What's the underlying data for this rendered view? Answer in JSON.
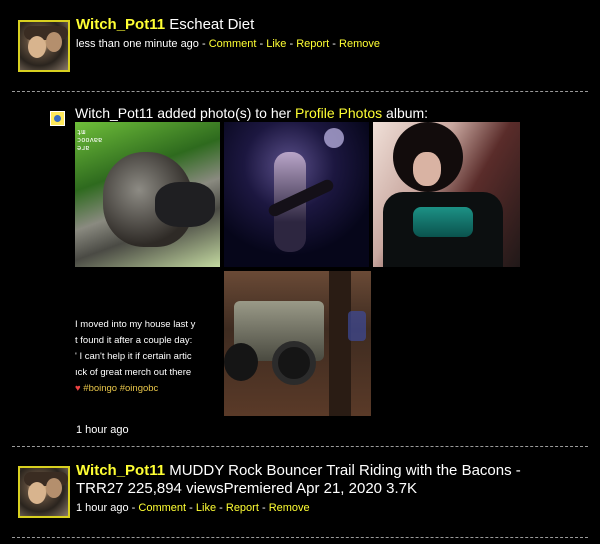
{
  "posts": [
    {
      "user": "Witch_Pot11",
      "text": "Escheat Diet",
      "time": "less than one minute ago",
      "actions": [
        "Comment",
        "Like",
        "Report",
        "Remove"
      ]
    },
    {
      "user": "Witch_Pot11",
      "text": "MUDDY Rock Bouncer Trail Riding with the Bacons -",
      "text2": "TRR27 225,894 viewsPremiered Apr 21, 2020 3.7K",
      "time": "1 hour ago",
      "actions": [
        "Comment",
        "Like",
        "Report",
        "Remove"
      ]
    }
  ],
  "album": {
    "prefix": "Witch_Pot11 added photo(s) to her",
    "album_name": "Profile Photos",
    "suffix": "album:",
    "time": "1 hour ago"
  },
  "photo_text": {
    "tag_lines": [
      "ʇɯ",
      "ɔooʌɐɐ",
      "ǝɹɐ"
    ],
    "lines": [
      "I moved into my house last y",
      "t found it after a couple day:",
      "' I can't help it if certain artic",
      "ıck of great merch out there"
    ],
    "hashtags": "#boingo #oingobc"
  },
  "colors": {
    "link": "#ffff33",
    "background": "#000000",
    "divider": "#9a9a9a"
  }
}
